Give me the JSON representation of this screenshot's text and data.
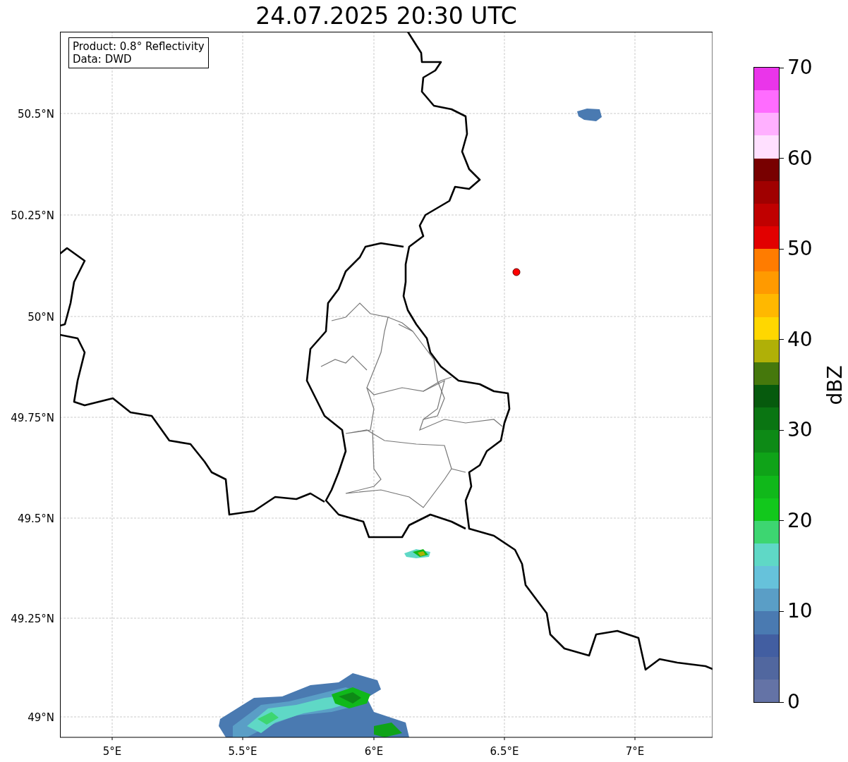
{
  "title": "24.07.2025 20:30 UTC",
  "info_box": [
    "Product: 0.8° Reflectivity",
    "Data: DWD"
  ],
  "map": {
    "lon_labels": [
      "5°E",
      "5.5°E",
      "6°E",
      "6.5°E",
      "7°E"
    ],
    "lat_labels": [
      "50.5°N",
      "50.25°N",
      "50°N",
      "49.75°N",
      "49.5°N",
      "49.25°N",
      "49°N"
    ]
  },
  "colorbar": {
    "label": "dBZ",
    "ticks": [
      "70",
      "60",
      "50",
      "40",
      "30",
      "20",
      "10",
      "0"
    ],
    "segments": [
      {
        "color": "#6473a6"
      },
      {
        "color": "#51679f"
      },
      {
        "color": "#425ea1"
      },
      {
        "color": "#4a7ab1"
      },
      {
        "color": "#5a9ec6"
      },
      {
        "color": "#66c2db"
      },
      {
        "color": "#5fd8c6"
      },
      {
        "color": "#3dd671"
      },
      {
        "color": "#12c81c"
      },
      {
        "color": "#10b81a"
      },
      {
        "color": "#0fa318"
      },
      {
        "color": "#0d8a16"
      },
      {
        "color": "#0a7512"
      },
      {
        "color": "#065a0d"
      },
      {
        "color": "#45780c"
      },
      {
        "color": "#b0b007"
      },
      {
        "color": "#ffd700"
      },
      {
        "color": "#ffb800"
      },
      {
        "color": "#ff9a00"
      },
      {
        "color": "#ff7c00"
      },
      {
        "color": "#e20000"
      },
      {
        "color": "#c00000"
      },
      {
        "color": "#a00000"
      },
      {
        "color": "#780000"
      },
      {
        "color": "#ffe0ff"
      },
      {
        "color": "#ffb0ff"
      },
      {
        "color": "#ff6cff"
      },
      {
        "color": "#ea35ea"
      }
    ]
  }
}
